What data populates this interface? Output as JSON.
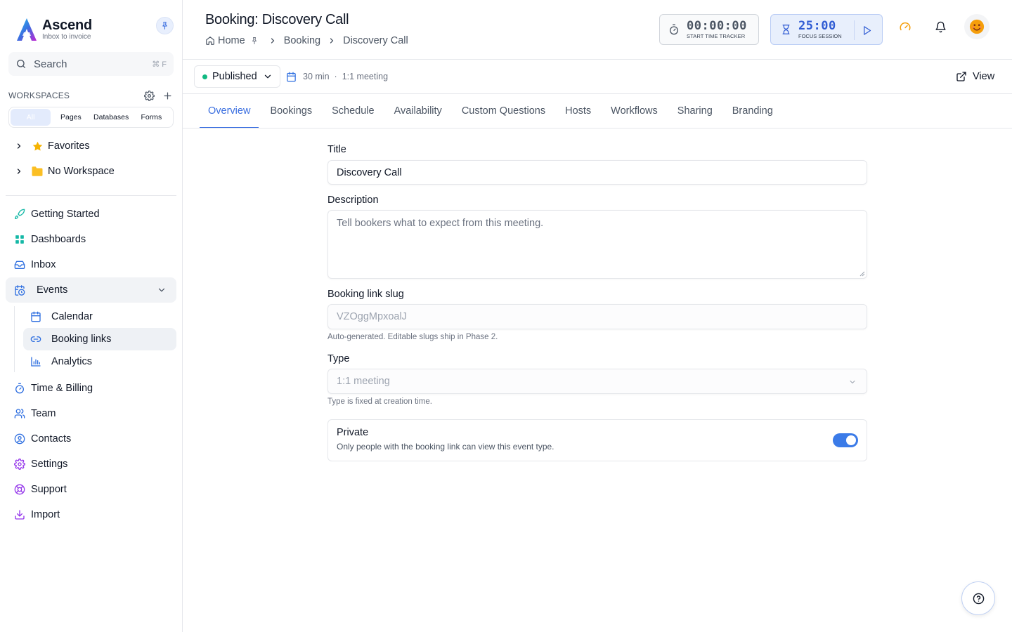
{
  "brand": {
    "name": "Ascend",
    "tagline": "Inbox to invoice"
  },
  "sidebar": {
    "search": {
      "label": "Search",
      "shortcut": "⌘ F"
    },
    "workspaces": {
      "title": "WORKSPACES",
      "tabs": [
        "All",
        "Pages",
        "Databases",
        "Forms"
      ],
      "active_tab": "All",
      "tree": [
        {
          "label": "Favorites",
          "icon": "star-icon"
        },
        {
          "label": "No Workspace",
          "icon": "folder-icon"
        }
      ]
    },
    "nav": [
      {
        "label": "Getting Started",
        "icon": "rocket-icon"
      },
      {
        "label": "Dashboards",
        "icon": "grid-icon"
      },
      {
        "label": "Inbox",
        "icon": "inbox-icon"
      },
      {
        "label": "Events",
        "icon": "calendar-clock-icon",
        "expanded": true
      },
      {
        "label": "Time & Billing",
        "icon": "stopwatch-icon"
      },
      {
        "label": "Team",
        "icon": "users-icon"
      },
      {
        "label": "Contacts",
        "icon": "user-circle-icon"
      },
      {
        "label": "Settings",
        "icon": "gear-icon"
      },
      {
        "label": "Support",
        "icon": "lifebuoy-icon"
      },
      {
        "label": "Import",
        "icon": "download-icon"
      }
    ],
    "events_sub": [
      {
        "label": "Calendar",
        "icon": "calendar-icon"
      },
      {
        "label": "Booking links",
        "icon": "link-icon",
        "active": true
      },
      {
        "label": "Analytics",
        "icon": "bar-chart-icon"
      }
    ]
  },
  "header": {
    "title": "Booking: Discovery Call",
    "breadcrumb": [
      "Home",
      "Booking",
      "Discovery Call"
    ],
    "time_tracker": {
      "time": "00:00:00",
      "caption": "START TIME TRACKER"
    },
    "focus": {
      "time": "25:00",
      "caption": "FOCUS SESSION"
    }
  },
  "toolbar": {
    "status": "Published",
    "duration": "30 min",
    "separator": "·",
    "meeting_type": "1:1 meeting",
    "view_label": "View"
  },
  "tabs": [
    "Overview",
    "Bookings",
    "Schedule",
    "Availability",
    "Custom Questions",
    "Hosts",
    "Workflows",
    "Sharing",
    "Branding"
  ],
  "active_tab": "Overview",
  "form": {
    "title_label": "Title",
    "title_value": "Discovery Call",
    "description_label": "Description",
    "description_placeholder": "Tell bookers what to expect from this meeting.",
    "slug_label": "Booking link slug",
    "slug_value": "VZOggMpxoalJ",
    "slug_help": "Auto-generated. Editable slugs ship in Phase 2.",
    "type_label": "Type",
    "type_value": "1:1 meeting",
    "type_help": "Type is fixed at creation time.",
    "private_title": "Private",
    "private_desc": "Only people with the booking link can view this event type.",
    "private_on": true
  },
  "colors": {
    "accent": "#3b6fe0",
    "status_green": "#10b981",
    "toggle_on": "#3b7be8"
  }
}
